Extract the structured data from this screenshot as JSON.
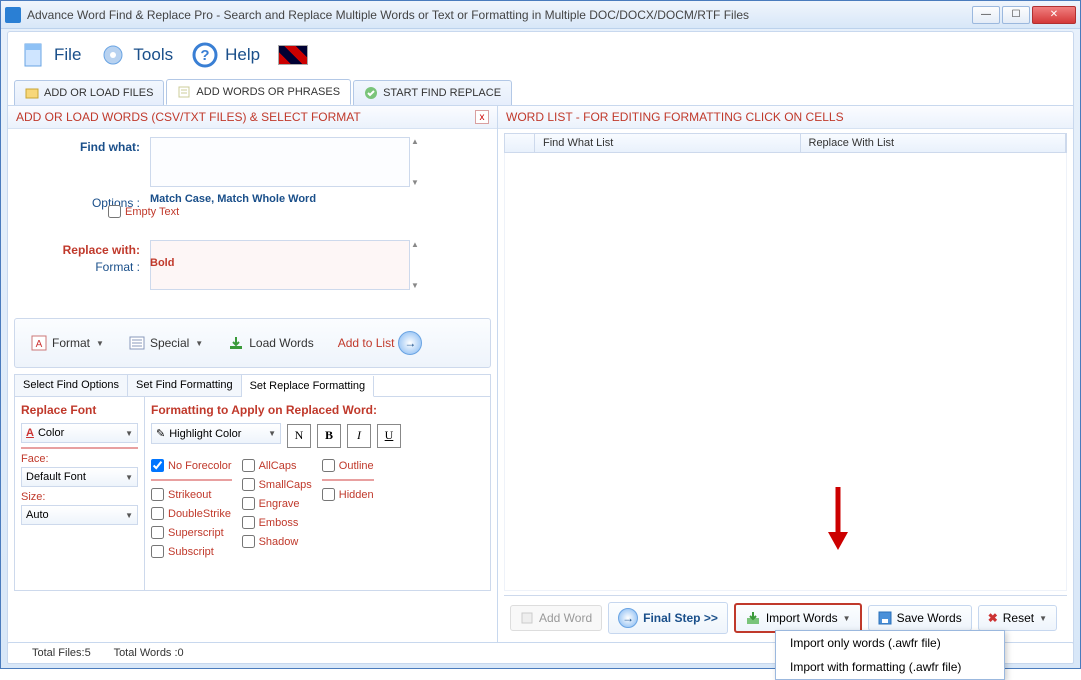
{
  "window": {
    "title": "Advance Word Find & Replace Pro - Search and Replace Multiple Words or Text  or Formatting in Multiple DOC/DOCX/DOCM/RTF Files"
  },
  "menu": {
    "file": "File",
    "tools": "Tools",
    "help": "Help"
  },
  "tabs": {
    "addfiles": "ADD OR LOAD FILES",
    "addwords": "ADD WORDS OR PHRASES",
    "start": "START FIND REPLACE"
  },
  "leftpanel": {
    "title": "ADD OR LOAD WORDS (CSV/TXT FILES) & SELECT FORMAT",
    "findwhat": "Find what:",
    "options_lbl": "Options :",
    "options_val": "Match Case, Match Whole Word",
    "replacewith": "Replace with:",
    "emptytext": "Empty Text",
    "format_lbl": "Format :",
    "format_val": "Bold"
  },
  "toolbar": {
    "format": "Format",
    "special": "Special",
    "loadwords": "Load Words",
    "addtolist": "Add to List"
  },
  "subtabs": {
    "findopts": "Select Find Options",
    "findfmt": "Set Find Formatting",
    "replfmt": "Set Replace Formatting"
  },
  "replfont": {
    "header": "Replace Font",
    "color": "Color",
    "face_lbl": "Face:",
    "face_val": "Default Font",
    "size_lbl": "Size:",
    "size_val": "Auto"
  },
  "replformat": {
    "header": "Formatting to Apply on Replaced Word:",
    "highlight": "Highlight Color",
    "n": "N",
    "b": "B",
    "i": "I",
    "u": "U",
    "noforecolor": "No Forecolor",
    "strikeout": "Strikeout",
    "doublestrike": "DoubleStrike",
    "superscript": "Superscript",
    "subscript": "Subscript",
    "allcaps": "AllCaps",
    "smallcaps": "SmallCaps",
    "engrave": "Engrave",
    "emboss": "Emboss",
    "shadow": "Shadow",
    "outline": "Outline",
    "hidden": "Hidden"
  },
  "rightpanel": {
    "title": "WORD LIST - FOR EDITING FORMATTING CLICK ON CELLS",
    "col_find": "Find What List",
    "col_replace": "Replace With List"
  },
  "bottombar": {
    "addword": "Add Word",
    "final": "Final Step >>",
    "import": "Import Words",
    "save": "Save Words",
    "reset": "Reset"
  },
  "importmenu": {
    "onlywords": "Import only words (.awfr file)",
    "withfmt": "Import with formatting (.awfr file)"
  },
  "status": {
    "files": "Total Files:5",
    "words": "Total Words :0"
  }
}
